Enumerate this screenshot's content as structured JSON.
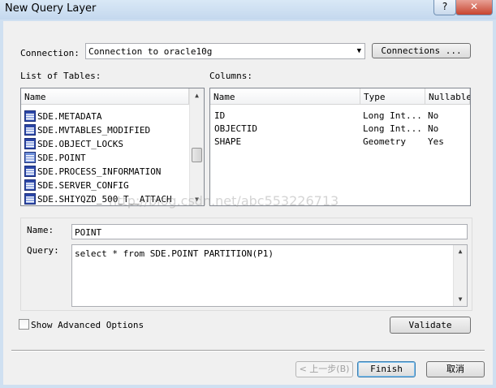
{
  "window": {
    "title": "New Query Layer",
    "help_label": "?",
    "close_label": "✕"
  },
  "connection": {
    "label": "Connection:",
    "value": "Connection to oracle10g",
    "connections_button": "Connections ..."
  },
  "tables": {
    "label": "List of Tables:",
    "header": "Name",
    "items": [
      "SDE.METADATA",
      "SDE.MVTABLES_MODIFIED",
      "SDE.OBJECT_LOCKS",
      "SDE.POINT",
      "SDE.PROCESS_INFORMATION",
      "SDE.SERVER_CONFIG",
      "SDE.SHIYQZD_500_T__ATTACH"
    ],
    "selected": "SDE.POINT"
  },
  "columns": {
    "label": "Columns:",
    "headers": [
      "Name",
      "Type",
      "Nullable"
    ],
    "rows": [
      [
        "ID",
        "Long Int...",
        "No"
      ],
      [
        "OBJECTID",
        "Long Int...",
        "No"
      ],
      [
        "SHAPE",
        "Geometry",
        "Yes"
      ]
    ]
  },
  "query": {
    "name_label": "Name:",
    "name_value": "POINT",
    "query_label": "Query:",
    "query_value": "select * from SDE.POINT PARTITION(P1)"
  },
  "options": {
    "show_advanced_label": "Show Advanced Options",
    "validate_button": "Validate"
  },
  "footer": {
    "back_button": "< 上一步(B)",
    "finish_button": "Finish",
    "cancel_button": "取消"
  },
  "watermark": "http://blog.csdn.net/abc553226713"
}
